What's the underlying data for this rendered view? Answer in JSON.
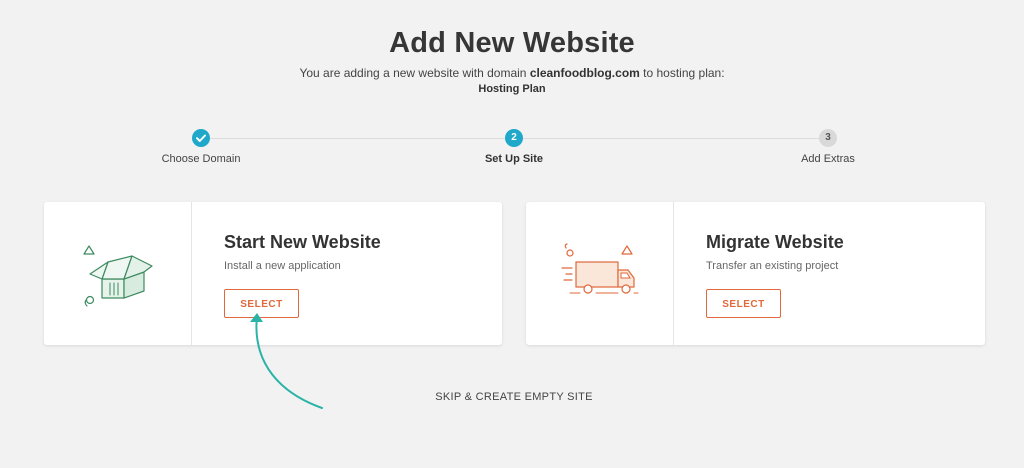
{
  "page": {
    "title": "Add New Website",
    "subtitle_prefix": "You are adding a new website with domain ",
    "domain": "cleanfoodblog.com",
    "subtitle_suffix": " to hosting plan:",
    "plan_name": "Hosting Plan"
  },
  "steps": [
    {
      "number": "✓",
      "label": "Choose Domain",
      "state": "done"
    },
    {
      "number": "2",
      "label": "Set Up Site",
      "state": "active"
    },
    {
      "number": "3",
      "label": "Add Extras",
      "state": "todo"
    }
  ],
  "cards": [
    {
      "title": "Start New Website",
      "description": "Install a new application",
      "button_label": "SELECT",
      "icon": "house-box-icon"
    },
    {
      "title": "Migrate Website",
      "description": "Transfer an existing project",
      "button_label": "SELECT",
      "icon": "moving-truck-icon"
    }
  ],
  "skip_label": "SKIP & CREATE EMPTY SITE",
  "colors": {
    "accent_teal": "#1fa8c9",
    "accent_orange": "#e0683a",
    "icon_green": "#3e8a60",
    "arrow_teal": "#2bb3a8",
    "background": "#f2f2f2"
  }
}
